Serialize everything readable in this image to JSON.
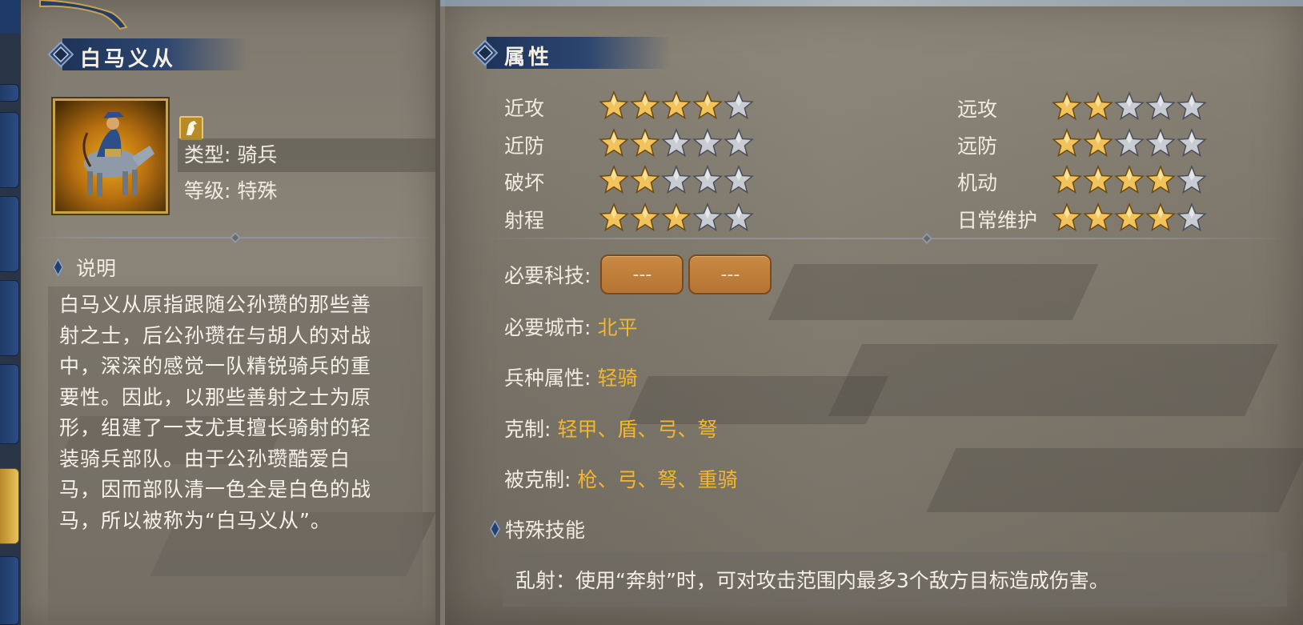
{
  "unit": {
    "name": "白马义从",
    "type_label": "类型: 骑兵",
    "level_label": "等级: 特殊",
    "portrait_icon": "horse-archer-icon",
    "badge_icon": "horse-head-icon"
  },
  "description": {
    "heading": "说明",
    "text": "白马义从原指跟随公孙瓒的那些善射之士，后公孙瓒在与胡人的对战中，深深的感觉一队精锐骑兵的重要性。因此，以那些善射之士为原形，组建了一支尤其擅长骑射的轻装骑兵部队。由于公孙瓒酷爱白马，因而部队清一色全是白色的战马，所以被称为“白马义从”。"
  },
  "attributes": {
    "heading": "属性",
    "stats": [
      {
        "label": "近攻",
        "rating": 4,
        "max": 5
      },
      {
        "label": "近防",
        "rating": 2,
        "max": 5
      },
      {
        "label": "破坏",
        "rating": 2,
        "max": 5
      },
      {
        "label": "射程",
        "rating": 3,
        "max": 5
      },
      {
        "label": "远攻",
        "rating": 2,
        "max": 5
      },
      {
        "label": "远防",
        "rating": 2,
        "max": 5
      },
      {
        "label": "机动",
        "rating": 4,
        "max": 5
      },
      {
        "label": "日常维护",
        "rating": 4,
        "max": 5
      }
    ]
  },
  "requirements": {
    "tech_label": "必要科技:",
    "tech_slots": [
      "---",
      "---"
    ],
    "city_label": "必要城市:",
    "city_value": "北平",
    "troop_label": "兵种属性:",
    "troop_value": "轻骑",
    "counters_label": "克制:",
    "counters_value": "轻甲、盾、弓、弩",
    "countered_label": "被克制:",
    "countered_value": "枪、弓、弩、重骑"
  },
  "skills": {
    "heading": "特殊技能",
    "text": "乱射：使用“奔射”时，可对攻击范围内最多3个敌方目标造成伤害。"
  },
  "colors": {
    "highlight": "#f3b62c",
    "header_blue": "#1f3358",
    "star_gold": "#f1c35a",
    "star_gray": "#c9cdd3"
  }
}
